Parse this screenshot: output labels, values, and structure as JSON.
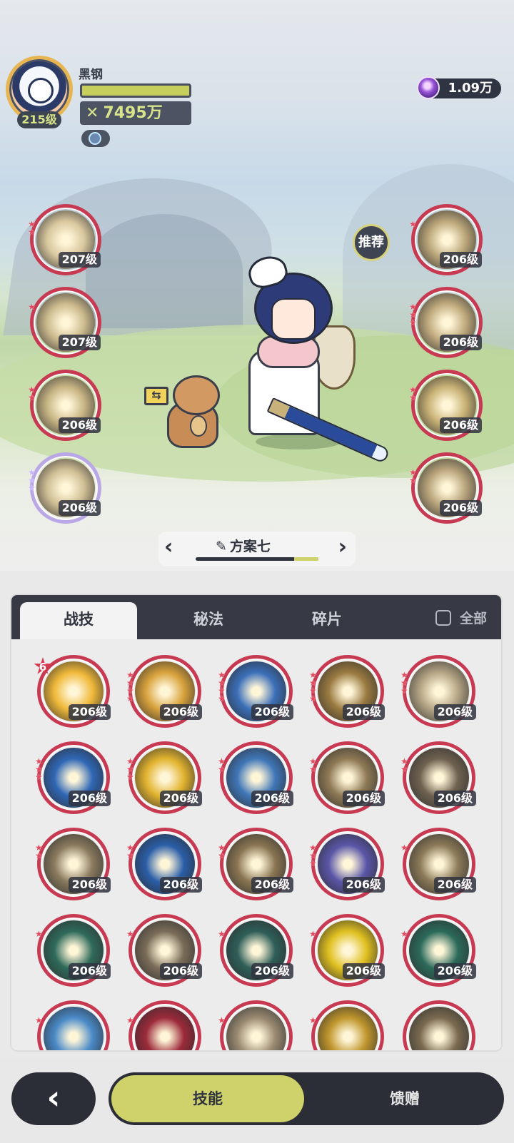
{
  "player": {
    "name": "黑钢",
    "level": "215级",
    "power": "7495万",
    "hp_fraction": 1.0
  },
  "currency": {
    "amount": "1.09万",
    "icon": "purple-gem-icon"
  },
  "equipped_left": [
    {
      "level": "207级",
      "stars": 2,
      "art": "#d9c79e"
    },
    {
      "level": "207级",
      "stars": 1,
      "art": "#cdbb8e"
    },
    {
      "level": "206级",
      "stars": 2,
      "art": "#c8b584"
    },
    {
      "level": "206级",
      "stars": 3,
      "art": "#d0bf95",
      "rainbow": true
    }
  ],
  "equipped_right": [
    {
      "level": "206级",
      "stars": 1,
      "art": "#bca77a"
    },
    {
      "level": "206级",
      "stars": 3,
      "art": "#c1ab7e"
    },
    {
      "level": "206级",
      "stars": 2,
      "art": "#c9b276"
    },
    {
      "level": "206级",
      "stars": 2,
      "art": "#b9a57c"
    }
  ],
  "recommend_label": "推荐",
  "swap_icon": "⇆",
  "preset": {
    "name": "方案七",
    "progress": 0.2
  },
  "tabs": {
    "skills": "战技",
    "secret": "秘法",
    "fragments": "碎片",
    "all_label": "全部",
    "all_checked": false
  },
  "grid_skills": [
    {
      "level": "206级",
      "rank": "6",
      "stars": 0,
      "art": "#f0b93a"
    },
    {
      "level": "206级",
      "stars": 4,
      "art": "#d8a23c"
    },
    {
      "level": "206级",
      "stars": 4,
      "art": "#3b6fb8"
    },
    {
      "level": "206级",
      "stars": 4,
      "art": "#9a7a40"
    },
    {
      "level": "206级",
      "stars": 3,
      "art": "#b5a585"
    },
    {
      "level": "206级",
      "stars": 3,
      "art": "#2f67b5"
    },
    {
      "level": "206级",
      "stars": 3,
      "art": "#e2b32f"
    },
    {
      "level": "206级",
      "stars": 2,
      "art": "#3f76b8"
    },
    {
      "level": "206级",
      "stars": 2,
      "art": "#8f7a55"
    },
    {
      "level": "206级",
      "stars": 2,
      "art": "#6f6250"
    },
    {
      "level": "206级",
      "stars": 2,
      "art": "#8a7a5e"
    },
    {
      "level": "206级",
      "stars": 2,
      "art": "#2a5ea8"
    },
    {
      "level": "206级",
      "stars": 2,
      "art": "#8a7552"
    },
    {
      "level": "206级",
      "stars": 3,
      "art": "#5a56a8"
    },
    {
      "level": "206级",
      "stars": 1,
      "art": "#8c7a58"
    },
    {
      "level": "206级",
      "stars": 1,
      "art": "#2f6a5a"
    },
    {
      "level": "206级",
      "stars": 1,
      "art": "#7a6c58"
    },
    {
      "level": "206级",
      "stars": 1,
      "art": "#2e5e58"
    },
    {
      "level": "206级",
      "stars": 1,
      "art": "#e0c020"
    },
    {
      "level": "206级",
      "stars": 1,
      "art": "#2b6a5a"
    },
    {
      "level": "",
      "stars": 1,
      "art": "#4a8ac8"
    },
    {
      "level": "",
      "stars": 1,
      "art": "#9c2a3a"
    },
    {
      "level": "",
      "stars": 1,
      "art": "#9a8a72"
    },
    {
      "level": "",
      "stars": 1,
      "art": "#c0962c"
    },
    {
      "level": "",
      "stars": 0,
      "art": "#7a6a50"
    }
  ],
  "bottom": {
    "back_icon": "chevron-left-icon",
    "skills_label": "技能",
    "gift_label": "馈赠"
  },
  "colors": {
    "accent": "#cfd26a",
    "dark": "#2b2e37",
    "ring": "#c73a52"
  }
}
